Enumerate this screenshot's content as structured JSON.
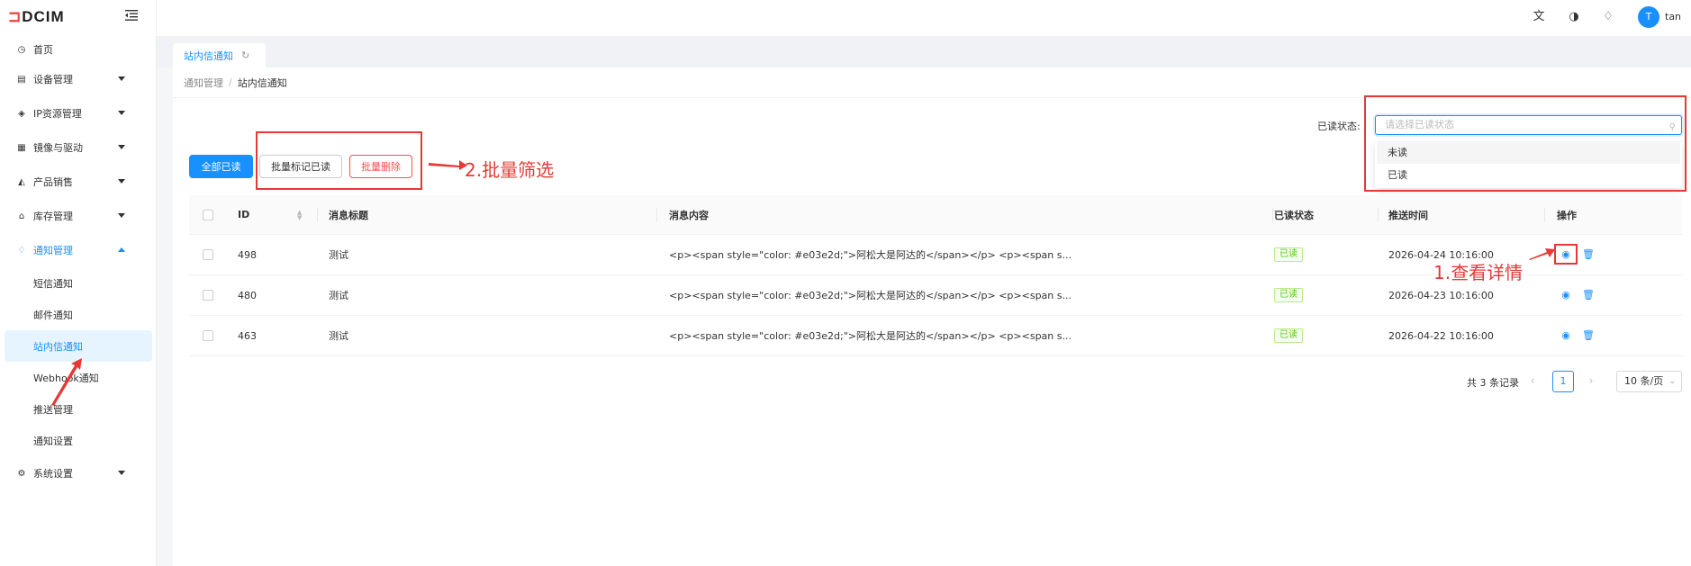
{
  "app": {
    "logo": "DCIM"
  },
  "sidebar": {
    "items": [
      {
        "label": "首页",
        "icon": "dashboard-icon"
      },
      {
        "label": "设备管理",
        "icon": "monitor-icon"
      },
      {
        "label": "IP资源管理",
        "icon": "network-icon"
      },
      {
        "label": "镜像与驱动",
        "icon": "image-icon"
      },
      {
        "label": "产品销售",
        "icon": "shop-icon"
      },
      {
        "label": "库存管理",
        "icon": "warehouse-icon"
      },
      {
        "label": "通知管理",
        "icon": "bell-icon"
      },
      {
        "label": "系统设置",
        "icon": "gear-icon"
      }
    ],
    "submenu": [
      "短信通知",
      "邮件通知",
      "站内信通知",
      "Webhook通知",
      "推送管理",
      "通知设置"
    ]
  },
  "header": {
    "user_initial": "T",
    "username": "tan"
  },
  "tabs": [
    {
      "label": "站内信通知"
    }
  ],
  "breadcrumb": {
    "parent": "通知管理",
    "current": "站内信通知"
  },
  "filter": {
    "label": "已读状态:",
    "placeholder": "请选择已读状态",
    "options": [
      "未读",
      "已读"
    ]
  },
  "toolbar": {
    "mark_all_read": "全部已读",
    "batch_mark_read": "批量标记已读",
    "batch_delete": "批量删除"
  },
  "table": {
    "columns": [
      "ID",
      "消息标题",
      "消息内容",
      "已读状态",
      "推送时间",
      "操作"
    ],
    "rows": [
      {
        "id": "498",
        "title": "测试",
        "content": "<p><span style=\"color: #e03e2d;\">阿松大是阿达的</span></p> <p><span s...",
        "status": "已读",
        "time": "2026-04-24 10:16:00"
      },
      {
        "id": "480",
        "title": "测试",
        "content": "<p><span style=\"color: #e03e2d;\">阿松大是阿达的</span></p> <p><span s...",
        "status": "已读",
        "time": "2026-04-23 10:16:00"
      },
      {
        "id": "463",
        "title": "测试",
        "content": "<p><span style=\"color: #e03e2d;\">阿松大是阿达的</span></p> <p><span s...",
        "status": "已读",
        "time": "2026-04-22 10:16:00"
      }
    ]
  },
  "pagination": {
    "total": "共 3 条记录",
    "current": "1",
    "page_size": "10 条/页"
  },
  "annotations": {
    "filter": "2.批量筛选",
    "detail": "1.查看详情"
  },
  "colors": {
    "primary": "#1890ff",
    "danger": "#ff4d4f",
    "annotation": "#e53935",
    "success": "#52c41a"
  }
}
